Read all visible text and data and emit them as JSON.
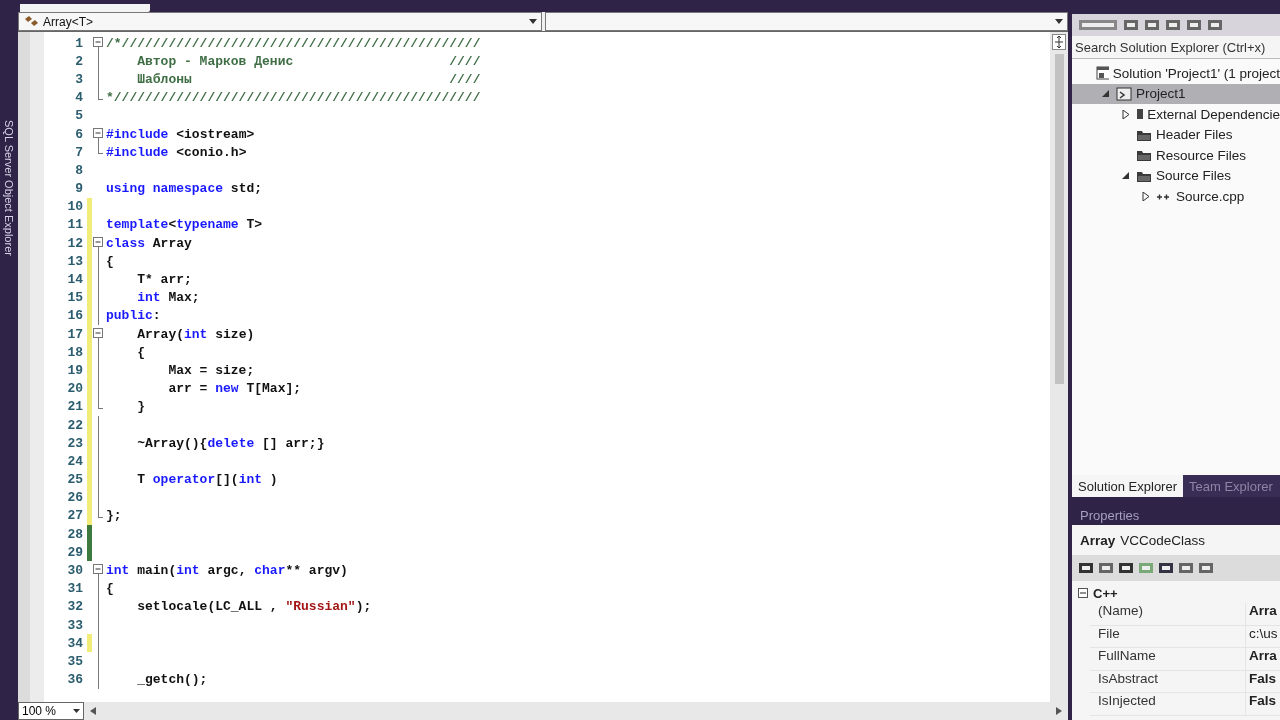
{
  "side_tabs": [
    "SQL Server Object Explorer"
  ],
  "navigation_bar": {
    "scope": "Array<T>"
  },
  "editor": {
    "zoom": "100 %",
    "lines": [
      {
        "num": "1",
        "fold": {
          "kind": "start"
        },
        "tokens": [
          {
            "kind": "comment",
            "text": "/*//////////////////////////////////////////////"
          }
        ]
      },
      {
        "num": "2",
        "fold": {
          "kind": "inside"
        },
        "tokens": [
          {
            "kind": "comment",
            "text": "    Автор - Марков Денис                    ////"
          }
        ]
      },
      {
        "num": "3",
        "fold": {
          "kind": "inside"
        },
        "tokens": [
          {
            "kind": "comment",
            "text": "    Шаблоны                                 ////"
          }
        ]
      },
      {
        "num": "4",
        "fold": {
          "kind": "end"
        },
        "tokens": [
          {
            "kind": "comment",
            "text": "*///////////////////////////////////////////////"
          }
        ]
      },
      {
        "num": "5"
      },
      {
        "num": "6",
        "fold": {
          "kind": "start"
        },
        "tokens": [
          {
            "kind": "keyword",
            "text": "#include"
          },
          {
            "kind": "plain",
            "text": " <iostream>"
          }
        ]
      },
      {
        "num": "7",
        "fold": {
          "kind": "end"
        },
        "tokens": [
          {
            "kind": "keyword",
            "text": "#include"
          },
          {
            "kind": "plain",
            "text": " <conio.h>"
          }
        ]
      },
      {
        "num": "8"
      },
      {
        "num": "9",
        "tokens": [
          {
            "kind": "keyword",
            "text": "using"
          },
          {
            "kind": "keyword",
            "text": " namespace"
          },
          {
            "kind": "plain",
            "text": " std;"
          }
        ]
      },
      {
        "num": "10",
        "marker": {
          "color": "#f2ec78"
        }
      },
      {
        "num": "11",
        "marker": {
          "color": "#f2ec78"
        },
        "tokens": [
          {
            "kind": "keyword",
            "text": "template"
          },
          {
            "kind": "plain",
            "text": "<"
          },
          {
            "kind": "keyword",
            "text": "typename"
          },
          {
            "kind": "plain",
            "text": " T>"
          }
        ]
      },
      {
        "num": "12",
        "marker": {
          "color": "#f2ec78"
        },
        "fold": {
          "kind": "start"
        },
        "tokens": [
          {
            "kind": "keyword",
            "text": "class"
          },
          {
            "kind": "plain",
            "text": " Array"
          }
        ]
      },
      {
        "num": "13",
        "marker": {
          "color": "#f2ec78"
        },
        "fold": {
          "kind": "inside"
        },
        "tokens": [
          {
            "kind": "plain",
            "text": "{"
          }
        ]
      },
      {
        "num": "14",
        "marker": {
          "color": "#f2ec78"
        },
        "fold": {
          "kind": "inside"
        },
        "tokens": [
          {
            "kind": "plain",
            "text": "    T* arr;"
          }
        ]
      },
      {
        "num": "15",
        "marker": {
          "color": "#f2ec78"
        },
        "fold": {
          "kind": "inside"
        },
        "tokens": [
          {
            "kind": "keyword",
            "text": "    int"
          },
          {
            "kind": "plain",
            "text": " Max;"
          }
        ]
      },
      {
        "num": "16",
        "marker": {
          "color": "#f2ec78"
        },
        "fold": {
          "kind": "inside"
        },
        "tokens": [
          {
            "kind": "keyword",
            "text": "public"
          },
          {
            "kind": "plain",
            "text": ":"
          }
        ]
      },
      {
        "num": "17",
        "marker": {
          "color": "#f2ec78"
        },
        "fold": {
          "kind": "start"
        },
        "tokens": [
          {
            "kind": "plain",
            "text": "    Array("
          },
          {
            "kind": "keyword",
            "text": "int"
          },
          {
            "kind": "plain",
            "text": " size)"
          }
        ]
      },
      {
        "num": "18",
        "marker": {
          "color": "#f2ec78"
        },
        "fold": {
          "kind": "inside"
        },
        "tokens": [
          {
            "kind": "plain",
            "text": "    {"
          }
        ]
      },
      {
        "num": "19",
        "marker": {
          "color": "#f2ec78"
        },
        "fold": {
          "kind": "inside"
        },
        "tokens": [
          {
            "kind": "plain",
            "text": "        Max = size;"
          }
        ]
      },
      {
        "num": "20",
        "marker": {
          "color": "#f2ec78"
        },
        "fold": {
          "kind": "inside"
        },
        "tokens": [
          {
            "kind": "plain",
            "text": "        arr = "
          },
          {
            "kind": "keyword",
            "text": "new"
          },
          {
            "kind": "plain",
            "text": " T[Max];"
          }
        ]
      },
      {
        "num": "21",
        "marker": {
          "color": "#f2ec78"
        },
        "fold": {
          "kind": "end"
        },
        "tokens": [
          {
            "kind": "plain",
            "text": "    }"
          }
        ]
      },
      {
        "num": "22",
        "marker": {
          "color": "#f2ec78"
        },
        "fold": {
          "kind": "inside"
        }
      },
      {
        "num": "23",
        "marker": {
          "color": "#f2ec78"
        },
        "fold": {
          "kind": "inside"
        },
        "tokens": [
          {
            "kind": "plain",
            "text": "    ~Array(){"
          },
          {
            "kind": "keyword",
            "text": "delete"
          },
          {
            "kind": "plain",
            "text": " [] arr;}"
          }
        ]
      },
      {
        "num": "24",
        "marker": {
          "color": "#f2ec78"
        },
        "fold": {
          "kind": "inside"
        }
      },
      {
        "num": "25",
        "marker": {
          "color": "#f2ec78"
        },
        "fold": {
          "kind": "inside"
        },
        "tokens": [
          {
            "kind": "plain",
            "text": "    T "
          },
          {
            "kind": "keyword",
            "text": "operator"
          },
          {
            "kind": "plain",
            "text": "[]("
          },
          {
            "kind": "keyword",
            "text": "int"
          },
          {
            "kind": "plain",
            "text": " )"
          }
        ]
      },
      {
        "num": "26",
        "marker": {
          "color": "#f2ec78"
        },
        "fold": {
          "kind": "inside"
        }
      },
      {
        "num": "27",
        "marker": {
          "color": "#f2ec78"
        },
        "fold": {
          "kind": "end"
        },
        "tokens": [
          {
            "kind": "plain",
            "text": "};"
          }
        ]
      },
      {
        "num": "28",
        "marker": {
          "color": "#3e7a3e"
        }
      },
      {
        "num": "29",
        "marker": {
          "color": "#3e7a3e"
        }
      },
      {
        "num": "30",
        "fold": {
          "kind": "start"
        },
        "tokens": [
          {
            "kind": "keyword",
            "text": "int"
          },
          {
            "kind": "plain",
            "text": " main("
          },
          {
            "kind": "keyword",
            "text": "int"
          },
          {
            "kind": "plain",
            "text": " argc, "
          },
          {
            "kind": "keyword",
            "text": "char"
          },
          {
            "kind": "plain",
            "text": "** argv)"
          }
        ]
      },
      {
        "num": "31",
        "fold": {
          "kind": "inside"
        },
        "tokens": [
          {
            "kind": "plain",
            "text": "{"
          }
        ]
      },
      {
        "num": "32",
        "fold": {
          "kind": "inside"
        },
        "tokens": [
          {
            "kind": "plain",
            "text": "    setlocale(LC_ALL , "
          },
          {
            "kind": "string",
            "text": "\"Russian\""
          },
          {
            "kind": "plain",
            "text": ");"
          }
        ]
      },
      {
        "num": "33",
        "fold": {
          "kind": "inside"
        }
      },
      {
        "num": "34",
        "marker": {
          "color": "#f2ec78"
        },
        "fold": {
          "kind": "inside"
        }
      },
      {
        "num": "35",
        "fold": {
          "kind": "inside"
        }
      },
      {
        "num": "36",
        "fold": {
          "kind": "inside"
        },
        "tokens": [
          {
            "kind": "plain",
            "text": "    _getch();"
          }
        ]
      }
    ]
  },
  "solution_explorer": {
    "search": {
      "placeholder": "Search Solution Explorer (Ctrl+x)"
    },
    "tree": [
      {
        "label": "Solution 'Project1' (1 project",
        "kind": "solution",
        "selected": false,
        "children": [
          {
            "label": "Project1",
            "kind": "project",
            "selected": true,
            "expanded": true,
            "children": [
              {
                "label": "External Dependencie",
                "kind": "references",
                "selected": false,
                "expanded": false
              },
              {
                "label": "Header Files",
                "kind": "folder",
                "selected": false
              },
              {
                "label": "Resource Files",
                "kind": "folder",
                "selected": false
              },
              {
                "label": "Source Files",
                "kind": "folder",
                "selected": false,
                "expanded": true,
                "children": [
                  {
                    "label": "Source.cpp",
                    "kind": "cpp",
                    "selected": false,
                    "expanded": false
                  }
                ]
              }
            ]
          }
        ]
      }
    ],
    "tabs": [
      {
        "label": "Solution Explorer",
        "selected": true
      },
      {
        "label": "Team Explorer",
        "selected": false
      }
    ]
  },
  "properties": {
    "title": "Properties",
    "object_name": "Array",
    "object_type": "VCCodeClass",
    "category": {
      "label": "C++",
      "expanded": true
    },
    "rows": [
      {
        "name": "(Name)",
        "value": "Arra"
      },
      {
        "name": "File",
        "value": "c:\\us"
      },
      {
        "name": "FullName",
        "value": "Arra"
      },
      {
        "name": "IsAbstract",
        "value": "Fals"
      },
      {
        "name": "IsInjected",
        "value": "Fals"
      }
    ]
  }
}
